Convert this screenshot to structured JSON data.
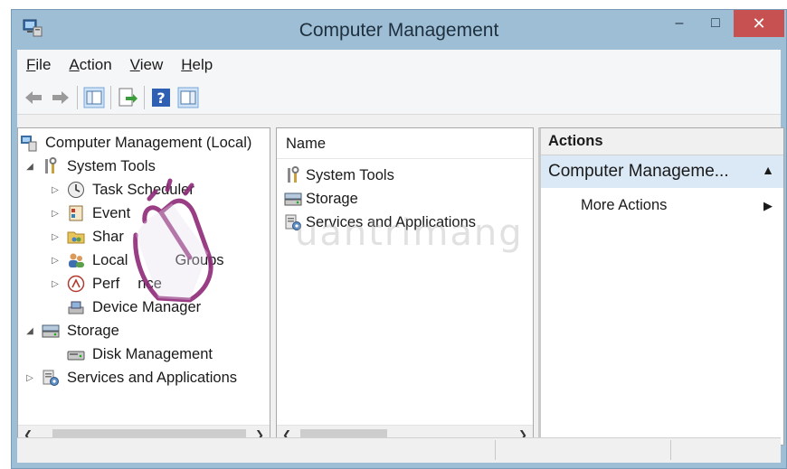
{
  "window": {
    "title": "Computer Management",
    "minimize": "–",
    "maximize": "□",
    "close": "✕"
  },
  "menu": [
    {
      "label": "File",
      "u": "F",
      "rest": "ile"
    },
    {
      "label": "Action",
      "u": "A",
      "rest": "ction"
    },
    {
      "label": "View",
      "u": "V",
      "rest": "iew"
    },
    {
      "label": "Help",
      "u": "H",
      "rest": "elp"
    }
  ],
  "toolbar": {
    "icons": [
      "back-arrow-icon",
      "forward-arrow-icon",
      "show-hide-console-tree-icon",
      "export-list-icon",
      "help-icon",
      "show-hide-action-pane-icon"
    ]
  },
  "tree": {
    "root": "Computer Management (Local)",
    "system_tools": "System Tools",
    "task_scheduler": "Task Scheduler",
    "event_viewer": "Event",
    "shared_folders": "Shar",
    "local_users_prefix": "Local",
    "local_users_suffix": "Groups",
    "performance_prefix": "Perf",
    "performance_suffix": "nce",
    "device_manager": "Device Manager",
    "storage": "Storage",
    "disk_management": "Disk Management",
    "services_apps": "Services and Applications"
  },
  "list": {
    "header": "Name",
    "items": [
      "System Tools",
      "Storage",
      "Services and Applications"
    ]
  },
  "actions": {
    "header": "Actions",
    "section": "Computer Manageme...",
    "more": "More Actions"
  },
  "watermark": "uantrimang",
  "colors": {
    "title_bg": "#9ebed6",
    "close_btn": "#c75050",
    "action_section_bg": "#dbe8f5"
  }
}
